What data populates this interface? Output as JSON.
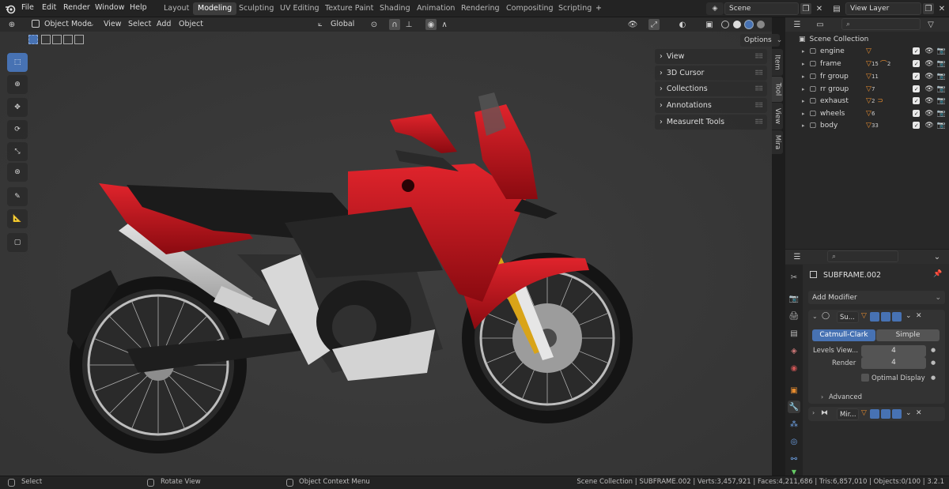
{
  "topbar": {
    "menus": [
      "File",
      "Edit",
      "Render",
      "Window",
      "Help"
    ],
    "workspaces": [
      "Layout",
      "Modeling",
      "Sculpting",
      "UV Editing",
      "Texture Paint",
      "Shading",
      "Animation",
      "Rendering",
      "Compositing",
      "Scripting"
    ],
    "active_workspace": "Modeling",
    "add_tab": "+",
    "scene": "Scene",
    "view_layer": "View Layer"
  },
  "viewport": {
    "mode": "Object Mode",
    "menus": [
      "View",
      "Select",
      "Add",
      "Object"
    ],
    "orientation": "Global",
    "options": "Options",
    "npanel": [
      "View",
      "3D Cursor",
      "Collections",
      "Annotations",
      "MeasureIt Tools"
    ],
    "side_tabs": [
      "Item",
      "Tool",
      "View",
      "Mira"
    ]
  },
  "outliner": {
    "root": "Scene Collection",
    "items": [
      {
        "name": "engine",
        "badge": ""
      },
      {
        "name": "frame",
        "badge": "15",
        "badge2": "2"
      },
      {
        "name": "fr group",
        "badge": "11"
      },
      {
        "name": "rr group",
        "badge": "7"
      },
      {
        "name": "exhaust",
        "badge": "2"
      },
      {
        "name": "wheels",
        "badge": "6"
      },
      {
        "name": "body",
        "badge": "33"
      }
    ]
  },
  "properties": {
    "object": "SUBFRAME.002",
    "add_modifier": "Add Modifier",
    "mod1": {
      "name": "Su...",
      "tab_a": "Catmull-Clark",
      "tab_b": "Simple",
      "levels_label": "Levels View...",
      "levels": "4",
      "render_label": "Render",
      "render": "4",
      "optimal": "Optimal Display",
      "advanced": "Advanced"
    },
    "mod2": {
      "name": "Mir..."
    }
  },
  "status": {
    "select": "Select",
    "rotate": "Rotate View",
    "context": "Object Context Menu",
    "info": "Scene Collection | SUBFRAME.002 | Verts:3,457,921 | Faces:4,211,686 | Tris:6,857,010 | Objects:0/100 | 3.2.1"
  },
  "colors": {
    "accent": "#4772b3",
    "viewport": "#393939",
    "bike_red": "#c0111a"
  }
}
